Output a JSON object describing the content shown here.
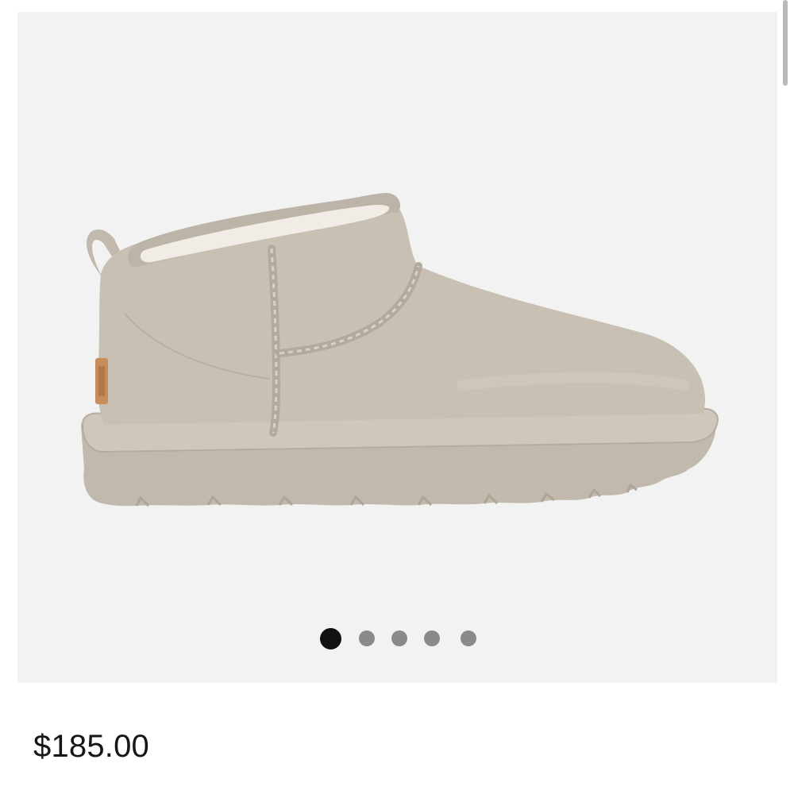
{
  "product": {
    "price": "$185.00",
    "image_icon": "ankle-boot-image",
    "boot_color": "#c9c0b4",
    "sole_color": "#c2b9ad",
    "fur_color": "#f1ede6",
    "label_color": "#c98d5c"
  },
  "gallery": {
    "background": "#f2f2f2",
    "total_images": 5,
    "active_index": 1,
    "dots": [
      {
        "state": "active"
      },
      {
        "state": "inactive"
      },
      {
        "state": "inactive"
      },
      {
        "state": "inactive"
      },
      {
        "state": "inactive"
      }
    ]
  }
}
